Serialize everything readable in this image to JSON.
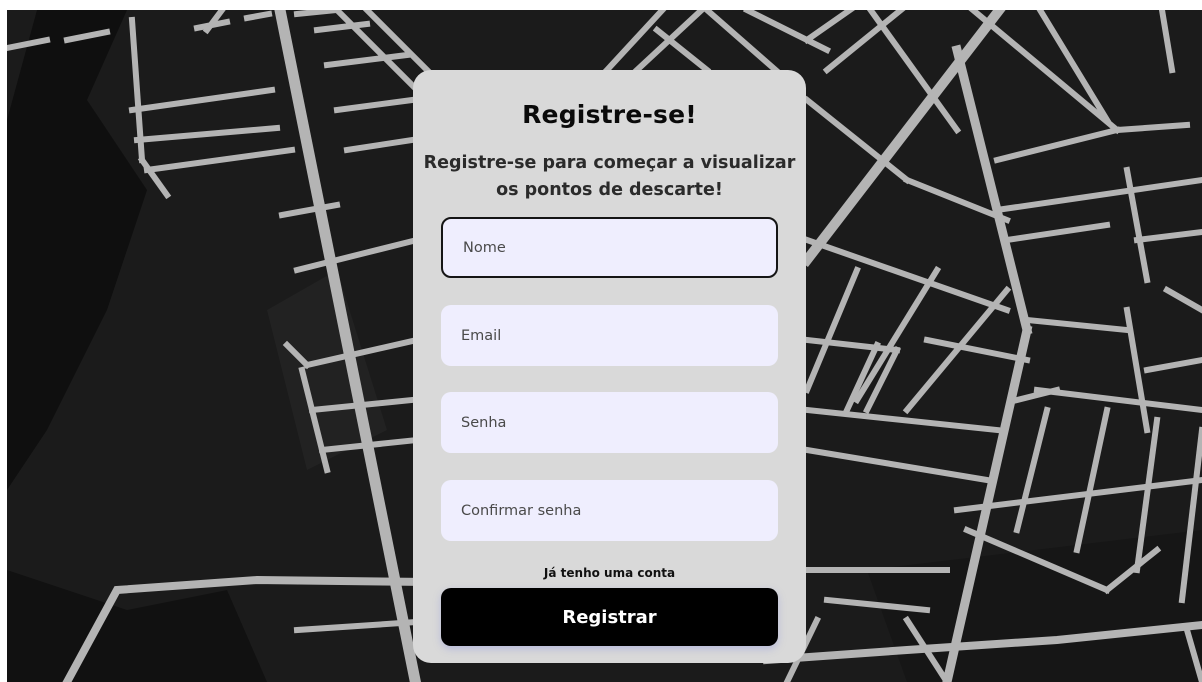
{
  "colors": {
    "map_background": "#1b1b1b",
    "map_roads": "#b4b4b4",
    "card_background": "#d9d9d9",
    "input_background": "#efeefe",
    "button_background": "#000000",
    "button_text": "#ffffff"
  },
  "form": {
    "title": "Registre-se!",
    "subtitle": "Registre-se para começar a visualizar os pontos de descarte!",
    "fields": {
      "name_placeholder": "Nome",
      "email_placeholder": "Email",
      "password_placeholder": "Senha",
      "confirm_password_placeholder": "Confirmar senha"
    },
    "login_link": "Já tenho uma conta",
    "submit_label": "Registrar"
  }
}
